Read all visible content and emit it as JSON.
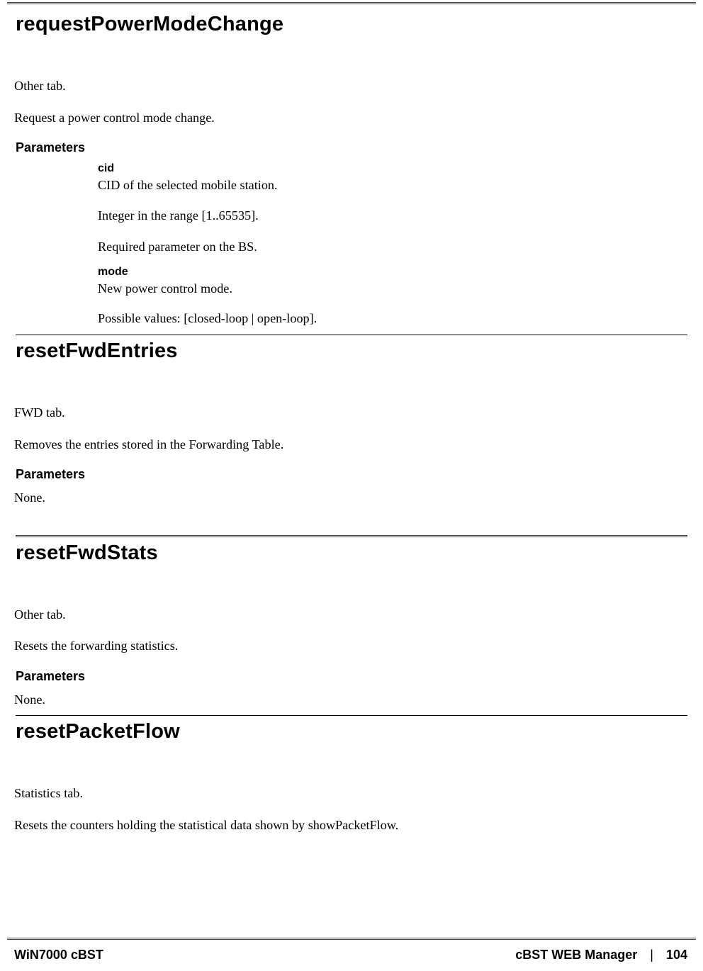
{
  "sections": [
    {
      "title": "requestPowerModeChange",
      "intro": [
        "Other tab.",
        "Request a power control mode change."
      ],
      "params_heading": "Parameters",
      "params": [
        {
          "name": "cid",
          "lines": [
            "CID of the selected mobile station.",
            "Integer in the range [1..65535].",
            "Required parameter on the BS."
          ]
        },
        {
          "name": "mode",
          "lines": [
            "New power control mode.",
            "Possible values: [closed-loop | open-loop]."
          ]
        }
      ]
    },
    {
      "title": "resetFwdEntries",
      "intro": [
        "FWD tab.",
        "Removes the entries stored in the Forwarding Table."
      ],
      "params_heading": "Parameters",
      "params_none": "None."
    },
    {
      "title": "resetFwdStats",
      "intro": [
        "Other tab.",
        "Resets the forwarding statistics."
      ],
      "params_heading": "Parameters",
      "params_none": "None."
    },
    {
      "title": "resetPacketFlow",
      "intro": [
        "Statistics tab.",
        "Resets the counters holding the statistical data shown by showPacketFlow."
      ]
    }
  ],
  "footer": {
    "left": "WiN7000 cBST",
    "mid": "cBST WEB Manager",
    "bar": "|",
    "page": "104"
  }
}
